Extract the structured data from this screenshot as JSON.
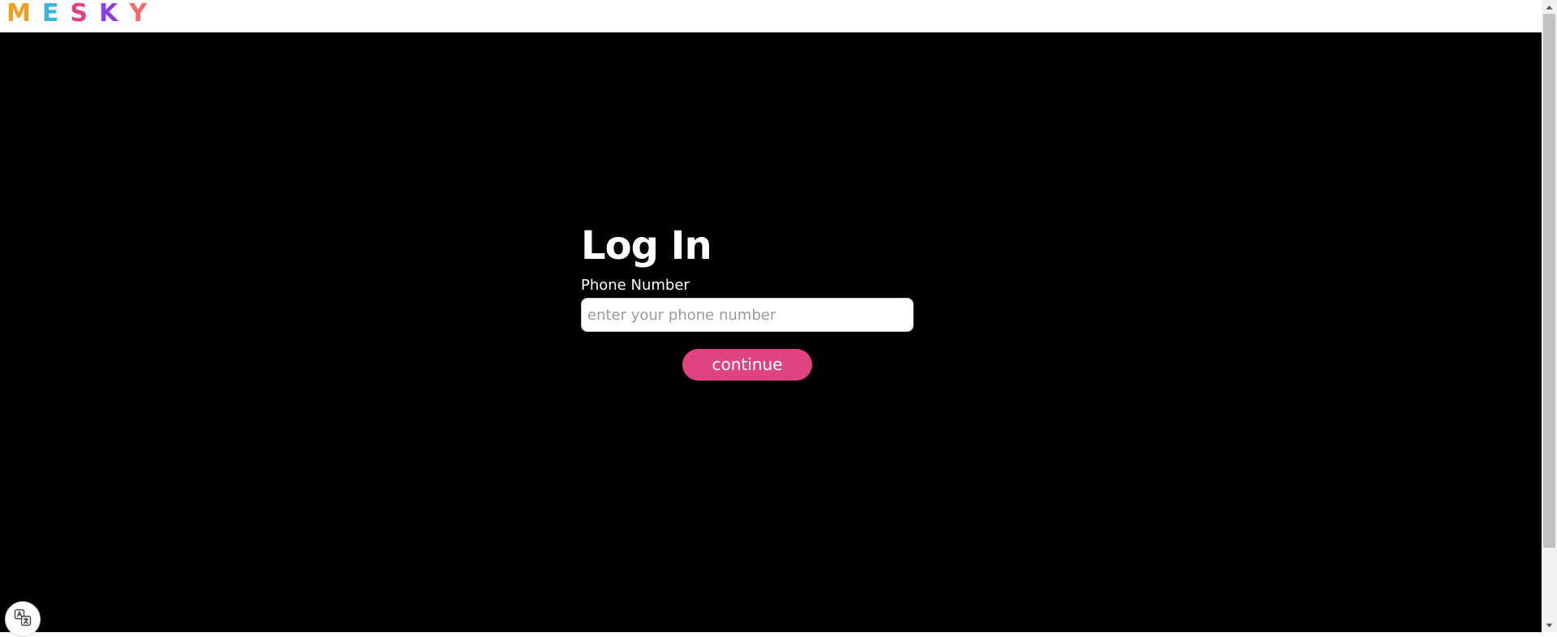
{
  "brand": {
    "letters": [
      {
        "char": "M",
        "color": "#f0a01e"
      },
      {
        "char": "E",
        "color": "#3bb3d6"
      },
      {
        "char": "S",
        "color": "#e0437f"
      },
      {
        "char": "K",
        "color": "#8a3fe0"
      },
      {
        "char": "Y",
        "color": "#f26b6b"
      }
    ]
  },
  "login": {
    "title": "Log In",
    "phone_label": "Phone Number",
    "phone_placeholder": "enter your phone number",
    "phone_value": "",
    "continue_label": "continue"
  },
  "colors": {
    "background": "#000000",
    "accent": "#e0437f",
    "topbar": "#ffffff"
  },
  "icons": {
    "translate": "translate-icon",
    "scroll_up": "scroll-up-arrow-icon",
    "scroll_down": "scroll-down-arrow-icon"
  }
}
